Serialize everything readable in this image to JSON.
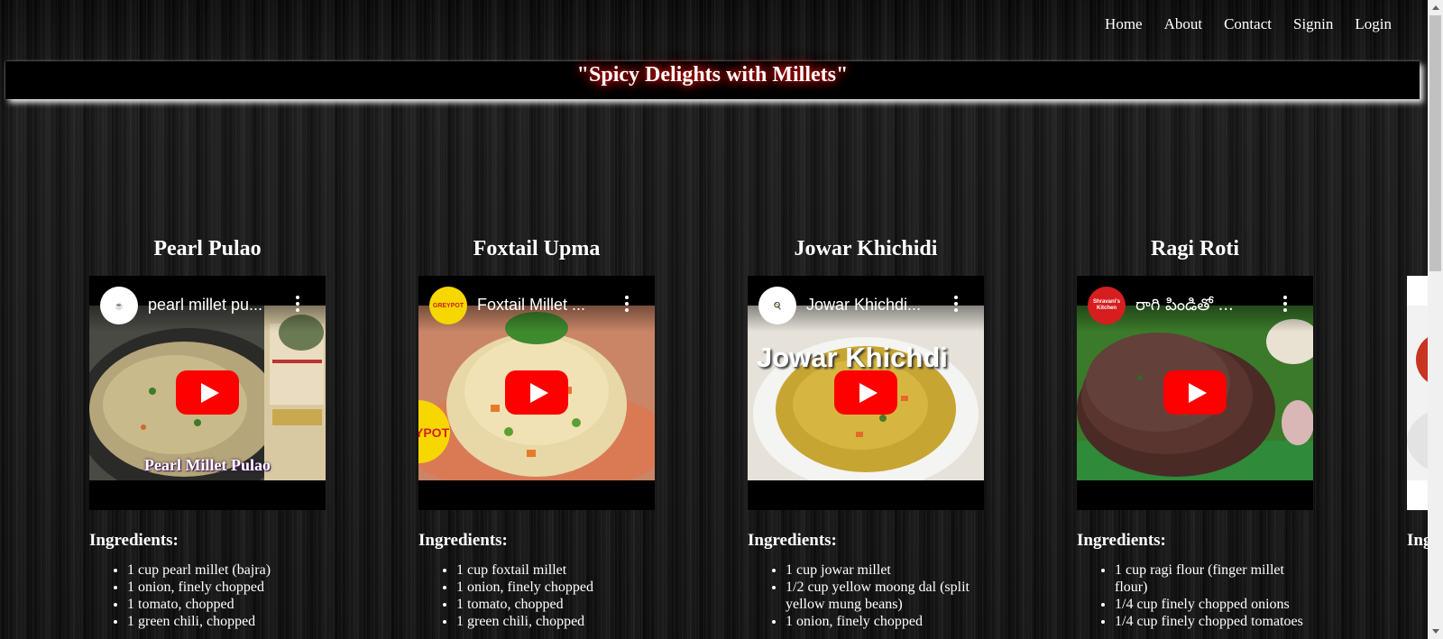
{
  "nav": [
    "Home",
    "About",
    "Contact",
    "Signin",
    "Login"
  ],
  "banner": {
    "title": "\"Spicy Delights with Millets\""
  },
  "ingredients_heading": "Ingredients:",
  "cards": [
    {
      "title": "Pearl Pulao",
      "video_title": "pearl millet pu...",
      "thumbnail_caption": "Pearl Millet Pulao",
      "ingredients": [
        "1 cup pearl millet (bajra)",
        "1 onion, finely chopped",
        "1 tomato, chopped",
        "1 green chili, chopped"
      ]
    },
    {
      "title": "Foxtail Upma",
      "video_title": "Foxtail Millet ...",
      "channel_label": "GREYPOT",
      "ingredients": [
        "1 cup foxtail millet",
        "1 onion, finely chopped",
        "1 tomato, chopped",
        "1 green chili, chopped"
      ]
    },
    {
      "title": "Jowar Khichidi",
      "video_title": "Jowar Khichdi...",
      "thumbnail_caption": "Jowar Khichdi",
      "ingredients": [
        "1 cup jowar millet",
        "1/2 cup yellow moong dal (split yellow mung beans)",
        "1 onion, finely chopped"
      ]
    },
    {
      "title": "Ragi Roti",
      "video_title": "రాగి పిండితో ...",
      "channel_label": "Shravani's Kitchen",
      "ingredients": [
        "1 cup ragi flour (finger millet flour)",
        "1/4 cup finely chopped onions",
        "1/4 cup finely chopped tomatoes"
      ]
    },
    {
      "ingredients_fragment": "Ing"
    }
  ]
}
